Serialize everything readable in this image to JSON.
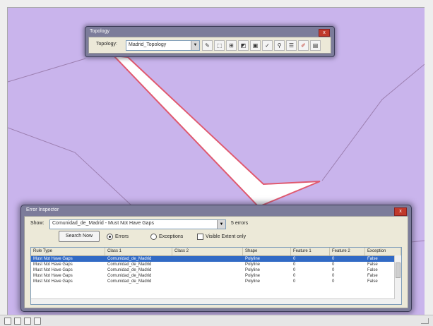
{
  "topology_toolbar": {
    "title": "Topology",
    "close_label": "x",
    "label": "Topology:",
    "selected_topology": "Madrid_Topology",
    "tools": [
      {
        "icon": "topology-edit-icon"
      },
      {
        "icon": "select-feature-icon"
      },
      {
        "icon": "map-topology-icon"
      },
      {
        "icon": "validate-extent-icon"
      },
      {
        "icon": "validate-visible-icon"
      },
      {
        "icon": "fix-error-icon"
      },
      {
        "icon": "error-inspector-icon"
      },
      {
        "icon": "topology-rules-icon"
      },
      {
        "icon": "edit-pencil-icon"
      },
      {
        "icon": "delete-icon"
      }
    ]
  },
  "error_inspector": {
    "title": "Error Inspector",
    "close_label": "x",
    "show_label": "Show:",
    "show_value": "Comunidad_de_Madrid - Must Not Have Gaps",
    "error_count": "5 errors",
    "search_button": "Search Now",
    "options": [
      {
        "label": "Errors",
        "type": "radio",
        "selected": true
      },
      {
        "label": "Exceptions",
        "type": "radio",
        "selected": false
      },
      {
        "label": "Visible Extent only",
        "type": "check",
        "selected": false
      }
    ],
    "columns": [
      "Rule Type",
      "Class 1",
      "Class 2",
      "Shape",
      "Feature 1",
      "Feature 2",
      "Exception"
    ],
    "rows": [
      [
        "Must Not Have Gaps",
        "Comunidad_de_Madrid",
        "",
        "Polyline",
        "0",
        "0",
        "False"
      ],
      [
        "Must Not Have Gaps",
        "Comunidad_de_Madrid",
        "",
        "Polyline",
        "0",
        "0",
        "False"
      ],
      [
        "Must Not Have Gaps",
        "Comunidad_de_Madrid",
        "",
        "Polyline",
        "0",
        "0",
        "False"
      ],
      [
        "Must Not Have Gaps",
        "Comunidad_de_Madrid",
        "",
        "Polyline",
        "0",
        "0",
        "False"
      ],
      [
        "Must Not Have Gaps",
        "Comunidad_de_Madrid",
        "",
        "Polyline",
        "0",
        "0",
        "False"
      ]
    ]
  },
  "status_bar": {
    "text": ""
  }
}
